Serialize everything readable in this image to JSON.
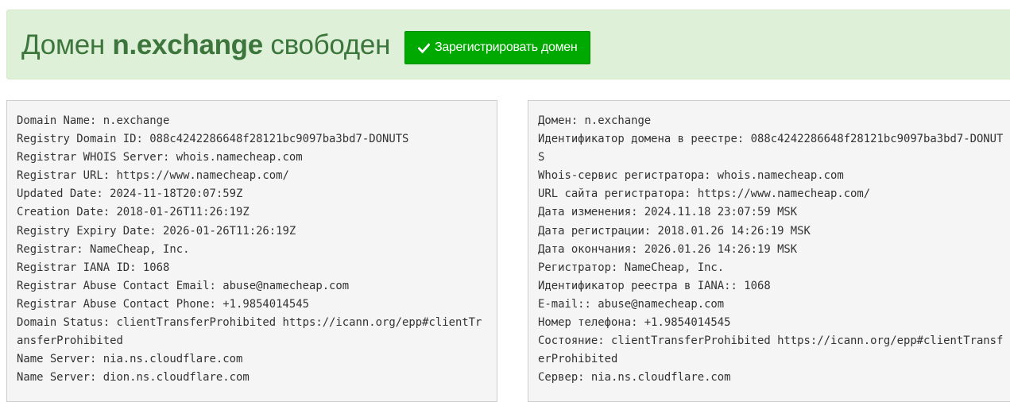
{
  "banner": {
    "prefix": "Домен",
    "domain": "n.exchange",
    "suffix": "свободен",
    "register_button": "Зарегистрировать домен",
    "button_icon": "checkmark-icon",
    "colors": {
      "banner_bg": "#dff0d8",
      "banner_text": "#3c763d",
      "button_bg": "#00a900"
    }
  },
  "whois_raw": [
    "Domain Name: n.exchange",
    "Registry Domain ID: 088c4242286648f28121bc9097ba3bd7-DONUTS",
    "Registrar WHOIS Server: whois.namecheap.com",
    "Registrar URL: https://www.namecheap.com/",
    "Updated Date: 2024-11-18T20:07:59Z",
    "Creation Date: 2018-01-26T11:26:19Z",
    "Registry Expiry Date: 2026-01-26T11:26:19Z",
    "Registrar: NameCheap, Inc.",
    "Registrar IANA ID: 1068",
    "Registrar Abuse Contact Email: abuse@namecheap.com",
    "Registrar Abuse Contact Phone: +1.9854014545",
    "Domain Status: clientTransferProhibited https://icann.org/epp#clientTransferProhibited",
    "Name Server: nia.ns.cloudflare.com",
    "Name Server: dion.ns.cloudflare.com"
  ],
  "whois_translated": [
    "Домен: n.exchange",
    "Идентификатор домена в реестре: 088c4242286648f28121bc9097ba3bd7-DONUTS",
    "Whois-сервис регистратора: whois.namecheap.com",
    "URL сайта регистратора: https://www.namecheap.com/",
    "Дата изменения: 2024.11.18 23:07:59 MSK",
    "Дата регистрации: 2018.01.26 14:26:19 MSK",
    "Дата окончания: 2026.01.26 14:26:19 MSK",
    "Регистратор: NameCheap, Inc.",
    "Идентификатор реестра в IANA:: 1068",
    "E-mail:: abuse@namecheap.com",
    "Номер телефона: +1.9854014545",
    "Состояние: clientTransferProhibited https://icann.org/epp#clientTransferProhibited",
    "Сервер: nia.ns.cloudflare.com"
  ]
}
